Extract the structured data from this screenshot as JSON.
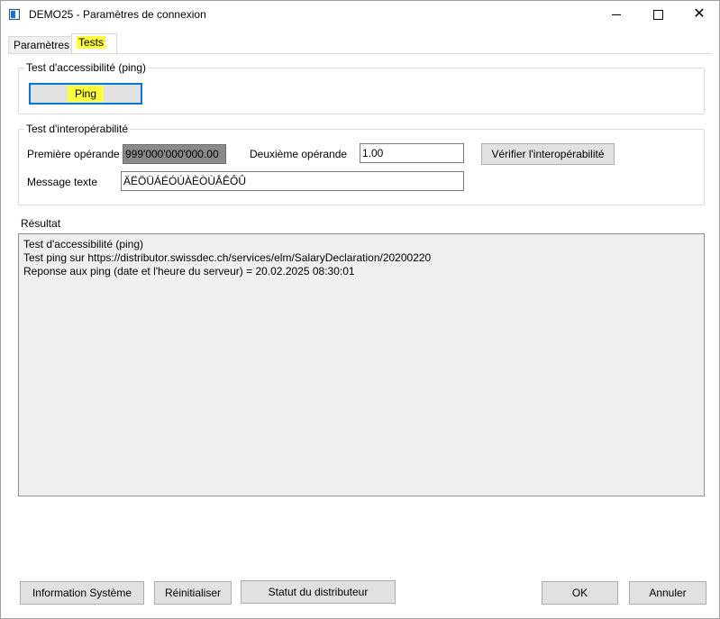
{
  "window": {
    "title": "DEMO25 - Paramètres de connexion",
    "highlight_color": "#ffff3c"
  },
  "tabs": [
    {
      "label": "Paramètres",
      "active": false
    },
    {
      "label": "Tests",
      "active": true
    }
  ],
  "ping_group": {
    "title": "Test d'accessibilité (ping)",
    "button_label": "Ping"
  },
  "interop_group": {
    "title": "Test d'interopérabilité",
    "first_operand_label": "Première opérande",
    "first_operand_value": "999'000'000'000.00",
    "second_operand_label": "Deuxième opérande",
    "second_operand_value": "1.00",
    "verify_button": "Vérifier l'interopérabilité",
    "message_label": "Message texte",
    "message_value": "ÄËÖÜÁÉÓÚÀÈÒÙÂÊÔÛ"
  },
  "result": {
    "label": "Résultat",
    "lines": [
      "Test d'accessibilité (ping)",
      "Test ping sur https://distributor.swissdec.ch/services/elm/SalaryDeclaration/20200220",
      "Reponse aux ping (date et l'heure du serveur) = 20.02.2025 08:30:01"
    ]
  },
  "footer": {
    "system_info": "Information Système",
    "reset": "Réinitialiser",
    "distributor_status": "Statut du distributeur",
    "ok": "OK",
    "cancel": "Annuler"
  }
}
